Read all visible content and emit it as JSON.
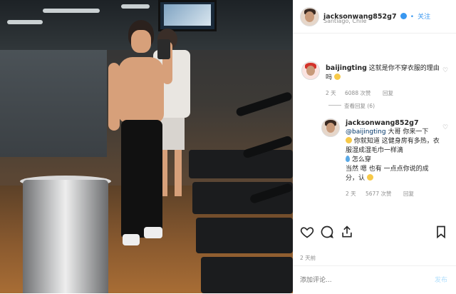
{
  "post": {
    "username": "jacksonwang852g7",
    "verified_icon": "verified-badge-icon",
    "follow_label": "关注",
    "location": "Santiago, Chile",
    "posted_ago": "2 天前",
    "comment_placeholder": "添加评论...",
    "post_label": "发布"
  },
  "comments": [
    {
      "username": "baijingting",
      "text": "这就是你不穿衣服的理由吗",
      "emoji": "grinning-face",
      "time": "2 天",
      "likes": "6088 次赞",
      "reply_label": "回复",
      "view_replies": "查看回复 (6)"
    }
  ],
  "reply": {
    "username": "jacksonwang852g7",
    "mention": "@baijingting",
    "line1": " 大哥 你来一下",
    "line2": "你就知道 这健身房有多热，衣服湿成湿毛巾一样滴",
    "line3": "怎么穿",
    "line4": "当然 嗯 也有 一点点你说的成分，认",
    "time": "2 天",
    "likes": "5677 次赞",
    "reply_label": "回复"
  },
  "colors": {
    "link": "#003569",
    "follow": "#3897f0",
    "muted": "#8e8e8e"
  }
}
